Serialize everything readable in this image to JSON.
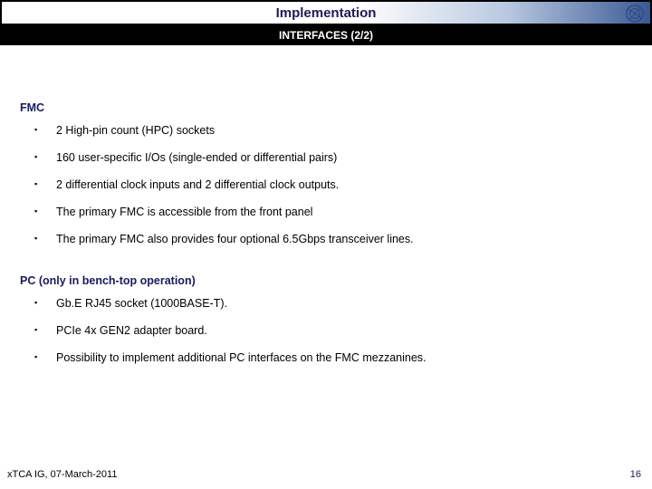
{
  "header": {
    "title": "Implementation",
    "subtitle": "INTERFACES (2/2)",
    "logo": "cern-logo"
  },
  "sections": [
    {
      "heading": "FMC",
      "items": [
        "2 High-pin count (HPC) sockets",
        "160 user-specific I/Os (single-ended or differential pairs)",
        "2 differential clock inputs and 2 differential clock outputs.",
        "The primary FMC is accessible from the front panel",
        "The primary FMC also provides four optional 6.5Gbps transceiver lines."
      ]
    },
    {
      "heading": "PC (only in bench-top operation)",
      "items": [
        "Gb.E RJ45 socket (1000BASE-T).",
        "PCIe 4x GEN2 adapter board.",
        "Possibility to implement additional PC interfaces on the FMC mezzanines."
      ]
    }
  ],
  "footer": {
    "left": "xTCA IG, 07-March-2011",
    "page": "16"
  }
}
